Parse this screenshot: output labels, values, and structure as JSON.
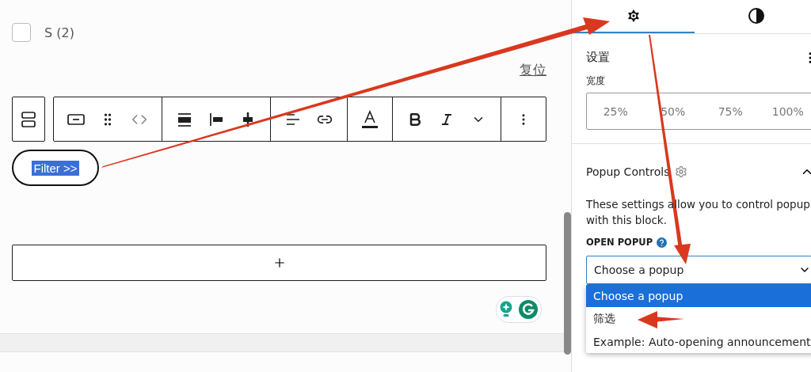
{
  "filters": [
    {
      "label": "S (2)",
      "checked": false
    }
  ],
  "reset_link": "复位",
  "block_button": {
    "label": "Filter >>",
    "text_selected": true
  },
  "sidebar": {
    "tabs": [
      {
        "kind": "settings",
        "selected": true
      },
      {
        "kind": "styles",
        "selected": false
      }
    ],
    "settings_title": "设置",
    "width_label": "宽度",
    "width_options": [
      {
        "label": "25%",
        "selected": false
      },
      {
        "label": "50%",
        "selected": false
      },
      {
        "label": "75%",
        "selected": false
      },
      {
        "label": "100%",
        "selected": false
      }
    ],
    "popup_controls": {
      "title": "Popup Controls",
      "expanded": true,
      "description": "These settings allow you to control popup",
      "description_2": "with this block.",
      "field_label": "OPEN POPUP",
      "select_value": "Choose a popup",
      "dropdown_open": true,
      "options": [
        {
          "label": "Choose a popup",
          "selected": true
        },
        {
          "label": "筛选",
          "selected": false
        },
        {
          "label": "Example: Auto-opening announcement",
          "selected": false
        }
      ]
    }
  }
}
